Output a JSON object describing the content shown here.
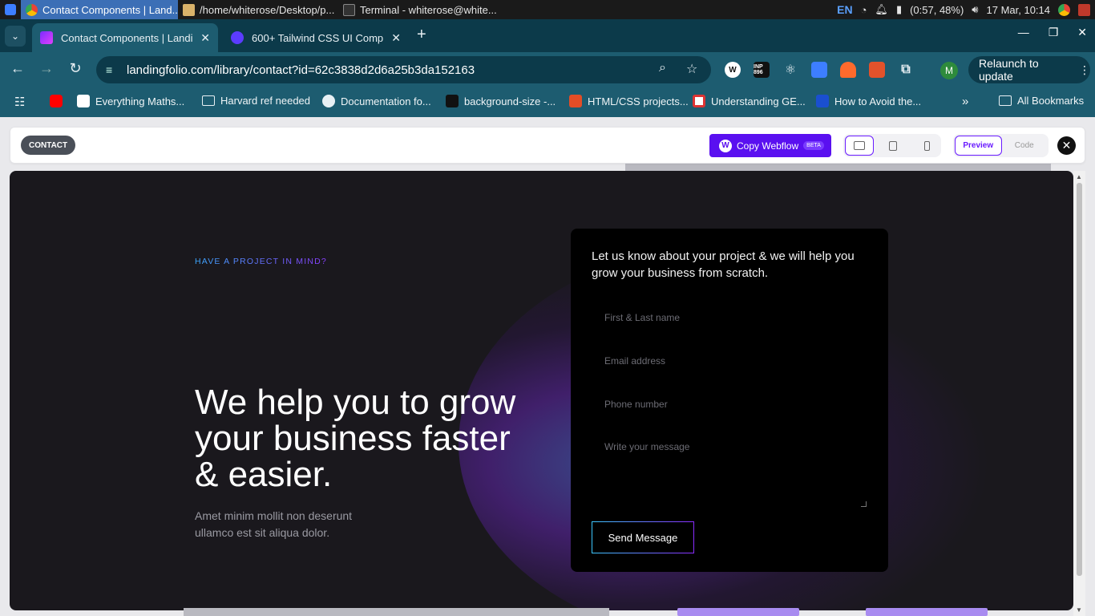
{
  "taskbar": {
    "windows": [
      {
        "title": "Contact Components | Land...",
        "active": true
      },
      {
        "title": "/home/whiterose/Desktop/p...",
        "active": false
      },
      {
        "title": "Terminal - whiterose@white...",
        "active": false
      }
    ],
    "lang": "EN",
    "battery": "(0:57, 48%)",
    "datetime": "17 Mar, 10:14"
  },
  "tabs": [
    {
      "title": "Contact Components | Landi",
      "active": true
    },
    {
      "title": "600+ Tailwind CSS UI Compon",
      "active": false
    }
  ],
  "toolbar": {
    "url": "landingfolio.com/library/contact?id=62c3838d2d6a25b3da152163",
    "profile_initial": "M",
    "relaunch_label": "Relaunch to update",
    "inp_badge": "INP 896"
  },
  "bookmarks": [
    {
      "label": "Everything Maths...",
      "type": "page"
    },
    {
      "label": "Harvard ref needed",
      "type": "folder"
    },
    {
      "label": "Documentation fo...",
      "type": "page"
    },
    {
      "label": "background-size -...",
      "type": "page"
    },
    {
      "label": "HTML/CSS projects...",
      "type": "page"
    },
    {
      "label": "Understanding GE...",
      "type": "page"
    },
    {
      "label": "How to Avoid the...",
      "type": "page"
    }
  ],
  "bookmarks_all": "All Bookmarks",
  "builder": {
    "section_tag": "CONTACT",
    "webflow_label": "Copy Webflow",
    "webflow_badge": "BETA",
    "preview_label": "Preview",
    "code_label": "Code",
    "active_device": "desktop"
  },
  "preview": {
    "eyebrow": "HAVE A PROJECT IN MIND?",
    "headline": "We help you to grow your business faster & easier.",
    "subcopy": "Amet minim mollit non deserunt ullamco est sit aliqua dolor.",
    "form": {
      "intro": "Let us know about your project & we will help you grow your business from scratch.",
      "name_placeholder": "First & Last name",
      "email_placeholder": "Email address",
      "phone_placeholder": "Phone number",
      "message_placeholder": "Write your message",
      "submit_label": "Send Message"
    }
  },
  "colors": {
    "accent": "#6a1bff",
    "chrome_dark": "#0c3a4a",
    "chrome_light": "#1d5c70",
    "preview_bg": "#1a181d"
  }
}
